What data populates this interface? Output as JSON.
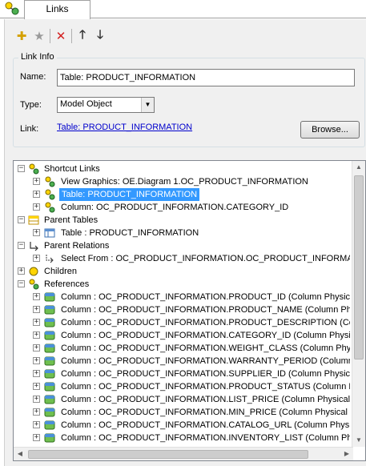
{
  "tab": {
    "label": "Links"
  },
  "toolbar": {
    "icons": [
      "add-icon",
      "star-icon",
      "delete-icon",
      "move-up-icon",
      "move-down-icon"
    ]
  },
  "link_info": {
    "legend": "Link Info",
    "name_label": "Name:",
    "name_value": "Table: PRODUCT_INFORMATION",
    "type_label": "Type:",
    "type_value": "Model Object",
    "link_label": "Link:",
    "link_value": "Table: PRODUCT_INFORMATION",
    "browse_label": "Browse..."
  },
  "tree": {
    "rows": [
      {
        "label": "Shortcut Links"
      },
      {
        "label": "View Graphics: OE.Diagram 1.OC_PRODUCT_INFORMATION"
      },
      {
        "label": "Table: PRODUCT_INFORMATION"
      },
      {
        "label": "Column: OC_PRODUCT_INFORMATION.CATEGORY_ID"
      },
      {
        "label": "Parent Tables"
      },
      {
        "label": "Table : PRODUCT_INFORMATION"
      },
      {
        "label": "Parent Relations"
      },
      {
        "label": "Select From : OC_PRODUCT_INFORMATION.OC_PRODUCT_INFORMAT"
      },
      {
        "label": "Children"
      },
      {
        "label": "References"
      },
      {
        "label": "Column : OC_PRODUCT_INFORMATION.PRODUCT_ID (Column Physical"
      },
      {
        "label": "Column : OC_PRODUCT_INFORMATION.PRODUCT_NAME (Column Phys"
      },
      {
        "label": "Column : OC_PRODUCT_INFORMATION.PRODUCT_DESCRIPTION (Colum"
      },
      {
        "label": "Column : OC_PRODUCT_INFORMATION.CATEGORY_ID (Column Physica"
      },
      {
        "label": "Column : OC_PRODUCT_INFORMATION.WEIGHT_CLASS (Column Physi"
      },
      {
        "label": "Column : OC_PRODUCT_INFORMATION.WARRANTY_PERIOD (Column"
      },
      {
        "label": "Column : OC_PRODUCT_INFORMATION.SUPPLIER_ID (Column Physical"
      },
      {
        "label": "Column : OC_PRODUCT_INFORMATION.PRODUCT_STATUS (Column Pl"
      },
      {
        "label": "Column : OC_PRODUCT_INFORMATION.LIST_PRICE (Column Physical O"
      },
      {
        "label": "Column : OC_PRODUCT_INFORMATION.MIN_PRICE (Column Physical Or"
      },
      {
        "label": "Column : OC_PRODUCT_INFORMATION.CATALOG_URL (Column Physica"
      },
      {
        "label": "Column : OC_PRODUCT_INFORMATION.INVENTORY_LIST (Column Phy"
      }
    ]
  }
}
